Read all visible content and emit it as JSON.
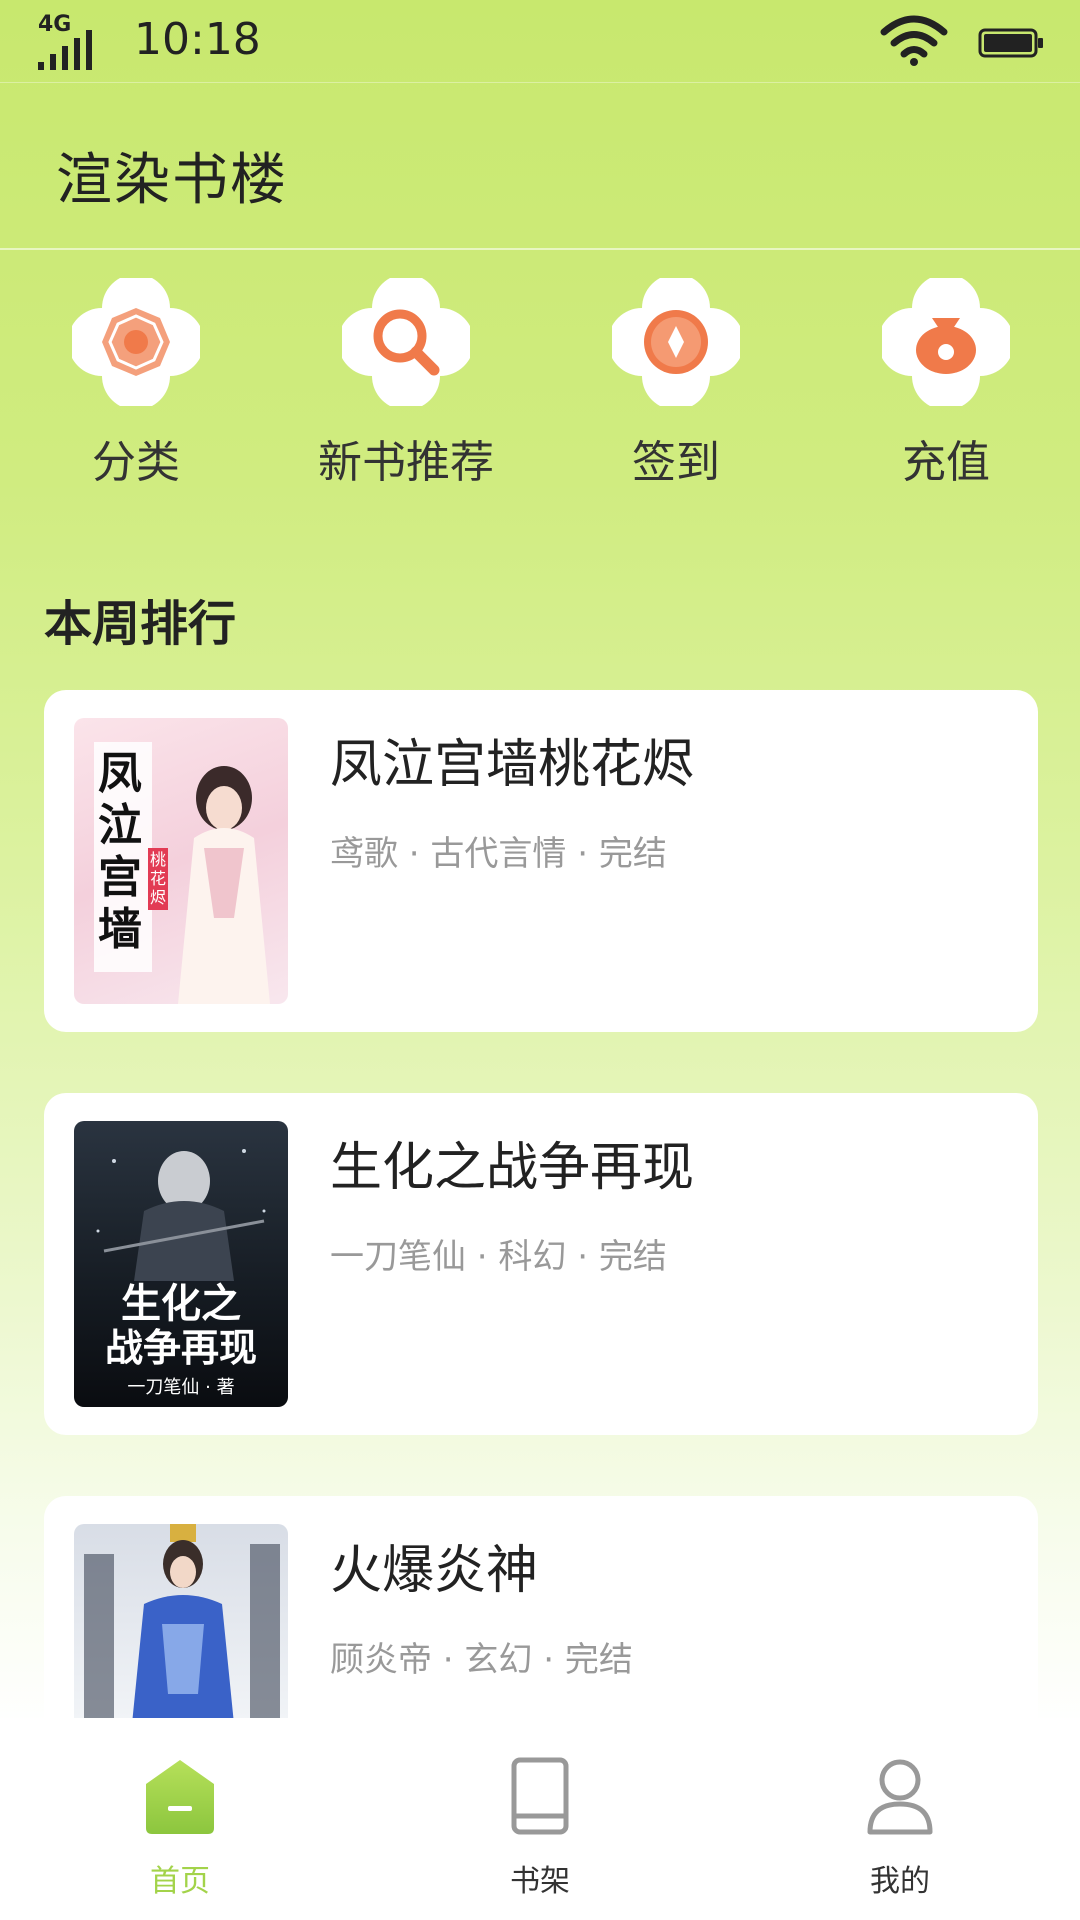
{
  "status_bar": {
    "network": "4G",
    "time": "10:18"
  },
  "app_title": "渲染书楼",
  "quick_actions": [
    {
      "label": "分类",
      "icon": "bagua-icon"
    },
    {
      "label": "新书推荐",
      "icon": "search-icon"
    },
    {
      "label": "签到",
      "icon": "coin-icon"
    },
    {
      "label": "充值",
      "icon": "money-bag-icon"
    }
  ],
  "section_title": "本周排行",
  "books": [
    {
      "title": "凤泣宫墙桃花烬",
      "meta": "鸢歌 · 古代言情 · 完结",
      "cover_text": "凤泣宫墙",
      "cover_tag": "桃花烬"
    },
    {
      "title": "生化之战争再现",
      "meta": "一刀笔仙 · 科幻 · 完结",
      "cover_text_1": "生化之",
      "cover_text_2": "战争再现",
      "cover_author": "一刀笔仙 · 著"
    },
    {
      "title": "火爆炎神",
      "meta": "顾炎帝 · 玄幻 · 完结"
    }
  ],
  "tabs": [
    {
      "label": "首页",
      "icon": "home-icon",
      "active": true
    },
    {
      "label": "书架",
      "icon": "bookshelf-icon",
      "active": false
    },
    {
      "label": "我的",
      "icon": "profile-icon",
      "active": false
    }
  ],
  "colors": {
    "accent": "#9ccf3a",
    "icon_orange": "#f07a4a",
    "tab_inactive": "#333333"
  }
}
